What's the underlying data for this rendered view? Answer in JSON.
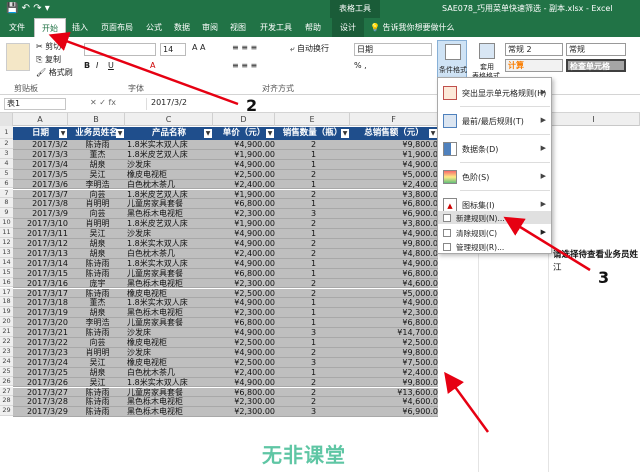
{
  "titlebar": {
    "context_tab": "表格工具",
    "title": "SAE078_巧用菜单快速筛选 - 副本.xlsx - Excel"
  },
  "tabs": [
    {
      "label": "文件"
    },
    {
      "label": "开始"
    },
    {
      "label": "插入"
    },
    {
      "label": "页面布局"
    },
    {
      "label": "公式"
    },
    {
      "label": "数据"
    },
    {
      "label": "审阅"
    },
    {
      "label": "视图"
    },
    {
      "label": "开发工具"
    },
    {
      "label": "帮助"
    },
    {
      "label": "设计"
    },
    {
      "label": "告诉我你想要做什么"
    }
  ],
  "ribbon": {
    "cut": "剪切",
    "copy": "复制",
    "format_painter": "格式刷",
    "clipboard": "剪贴板",
    "font_size": "14",
    "font_group": "字体",
    "wrap_text": "自动换行",
    "align_group": "对齐方式",
    "number_format": "日期",
    "conditional_format": "条件格式",
    "table_format": "套用",
    "table_format_line2": "表格格式",
    "style_normal2": "常规 2",
    "style_normal": "常规",
    "style_calc": "计算",
    "style_check": "检查单元格"
  },
  "formula_bar": {
    "name_box": "表1",
    "value": "2017/3/2"
  },
  "columns": [
    "A",
    "B",
    "C",
    "D",
    "E",
    "F",
    "G",
    "H",
    "I"
  ],
  "table": {
    "headers": [
      "日期",
      "业务员姓名",
      "产品名称",
      "单价（元）",
      "销售数量（瓶）",
      "总销售额（元）"
    ],
    "rows": [
      [
        "2017/3/2",
        "陈诗雨",
        "1.8米实木双人床",
        "¥4,900.00",
        "2",
        "¥9,800.0"
      ],
      [
        "2017/3/3",
        "董杰",
        "1.8米皮艺双人床",
        "¥1,900.00",
        "1",
        "¥1,900.0"
      ],
      [
        "2017/3/4",
        "胡泉",
        "沙发床",
        "¥4,900.00",
        "1",
        "¥4,900.0"
      ],
      [
        "2017/3/5",
        "吴江",
        "橡皮电视柜",
        "¥2,500.00",
        "2",
        "¥5,000.0"
      ],
      [
        "2017/3/6",
        "李明浩",
        "白色枕木茶几",
        "¥2,400.00",
        "1",
        "¥2,400.0"
      ],
      [
        "2017/3/7",
        "向芸",
        "1.8米皮艺双人床",
        "¥1,900.00",
        "2",
        "¥3,800.0"
      ],
      [
        "2017/3/8",
        "肖明明",
        "儿童房家具套餐",
        "¥6,800.00",
        "1",
        "¥6,800.0"
      ],
      [
        "2017/3/9",
        "向芸",
        "黑色栎木电视柜",
        "¥2,300.00",
        "3",
        "¥6,900.0"
      ],
      [
        "2017/3/10",
        "肖明明",
        "1.8米皮艺双人床",
        "¥1,900.00",
        "2",
        "¥3,800.0"
      ],
      [
        "2017/3/11",
        "吴江",
        "沙发床",
        "¥4,900.00",
        "1",
        "¥4,900.0"
      ],
      [
        "2017/3/12",
        "胡泉",
        "1.8米实木双人床",
        "¥4,900.00",
        "2",
        "¥9,800.0"
      ],
      [
        "2017/3/13",
        "胡泉",
        "白色枕木茶几",
        "¥2,400.00",
        "2",
        "¥4,800.0"
      ],
      [
        "2017/3/14",
        "陈诗雨",
        "1.8米实木双人床",
        "¥4,900.00",
        "1",
        "¥4,900.0"
      ],
      [
        "2017/3/15",
        "陈诗雨",
        "儿童房家具套餐",
        "¥6,800.00",
        "1",
        "¥6,800.0"
      ],
      [
        "2017/3/16",
        "庞宇",
        "黑色栎木电视柜",
        "¥2,300.00",
        "2",
        "¥4,600.0"
      ],
      [
        "2017/3/17",
        "陈诗雨",
        "橡皮电视柜",
        "¥2,500.00",
        "2",
        "¥5,000.0"
      ],
      [
        "2017/3/18",
        "董杰",
        "1.8米实木双人床",
        "¥4,900.00",
        "1",
        "¥4,900.0"
      ],
      [
        "2017/3/19",
        "胡泉",
        "黑色栎木电视柜",
        "¥2,300.00",
        "1",
        "¥2,300.0"
      ],
      [
        "2017/3/20",
        "李明浩",
        "儿童房家具套餐",
        "¥6,800.00",
        "1",
        "¥6,800.0"
      ],
      [
        "2017/3/21",
        "陈诗雨",
        "沙发床",
        "¥4,900.00",
        "3",
        "¥14,700.0"
      ],
      [
        "2017/3/22",
        "向芸",
        "橡皮电视柜",
        "¥2,500.00",
        "1",
        "¥2,500.0"
      ],
      [
        "2017/3/23",
        "肖明明",
        "沙发床",
        "¥4,900.00",
        "2",
        "¥9,800.0"
      ],
      [
        "2017/3/24",
        "吴江",
        "橡皮电视柜",
        "¥2,500.00",
        "3",
        "¥7,500.0"
      ],
      [
        "2017/3/25",
        "胡泉",
        "白色枕木茶几",
        "¥2,400.00",
        "1",
        "¥2,400.0"
      ],
      [
        "2017/3/26",
        "吴江",
        "1.8米实木双人床",
        "¥4,900.00",
        "2",
        "¥9,800.0"
      ],
      [
        "2017/3/27",
        "陈诗雨",
        "儿童房家具套餐",
        "¥6,800.00",
        "2",
        "¥13,600.0"
      ],
      [
        "2017/3/28",
        "陈诗雨",
        "黑色栎木电视柜",
        "¥2,300.00",
        "2",
        "¥4,600.0"
      ],
      [
        "2017/3/29",
        "陈诗雨",
        "黑色栎木电视柜",
        "¥2,300.00",
        "3",
        "¥6,900.0"
      ]
    ]
  },
  "menu": {
    "items": [
      {
        "label": "突出显示单元格规则(H)",
        "icon": "highlight-rules-icon"
      },
      {
        "label": "最前/最后规则(T)",
        "icon": "top-bottom-rules-icon"
      },
      {
        "label": "数据条(D)",
        "icon": "data-bars-icon"
      },
      {
        "label": "色阶(S)",
        "icon": "color-scales-icon"
      },
      {
        "label": "图标集(I)",
        "icon": "icon-sets-icon"
      }
    ],
    "new_rule": "新建规则(N)...",
    "clear_rules": "清除规则(C)",
    "manage_rules": "管理规则(R)..."
  },
  "side": {
    "prompt": "请选择待查看业务员姓",
    "value": "江"
  },
  "annotations": [
    "2",
    "3"
  ],
  "watermark": "无非课堂"
}
